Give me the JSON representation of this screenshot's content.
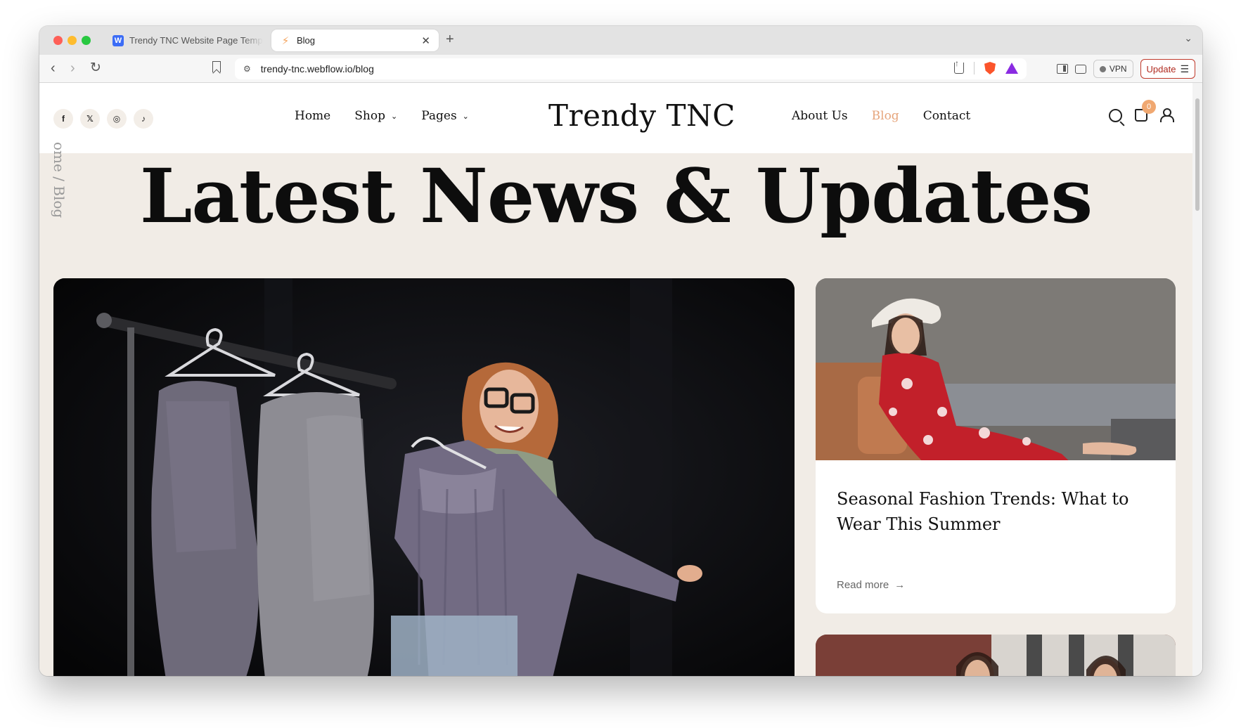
{
  "browser": {
    "tabs": [
      {
        "label": "Trendy TNC Website Page Templ",
        "favicon": "webflow-icon",
        "active": false
      },
      {
        "label": "Blog",
        "favicon": "bolt-icon",
        "active": true
      }
    ],
    "url": "trendy-tnc.webflow.io/blog",
    "vpn_label": "VPN",
    "update_label": "Update"
  },
  "site": {
    "brand": "Trendy TNC",
    "nav_left": [
      {
        "label": "Home",
        "dropdown": false
      },
      {
        "label": "Shop",
        "dropdown": true
      },
      {
        "label": "Pages",
        "dropdown": true
      }
    ],
    "nav_right": [
      {
        "label": "About Us",
        "active": false
      },
      {
        "label": "Blog",
        "active": true
      },
      {
        "label": "Contact",
        "active": false
      }
    ],
    "socials": [
      "facebook-icon",
      "x-icon",
      "instagram-icon",
      "tiktok-icon"
    ],
    "cart_count": "0",
    "accent_color": "#e6a57c"
  },
  "hero": {
    "breadcrumb": "ome / Blog",
    "title": "Latest News & Updates"
  },
  "posts": [
    {
      "title": "Seasonal Fashion Trends: What to Wear This Summer",
      "read_more": "Read more"
    }
  ]
}
